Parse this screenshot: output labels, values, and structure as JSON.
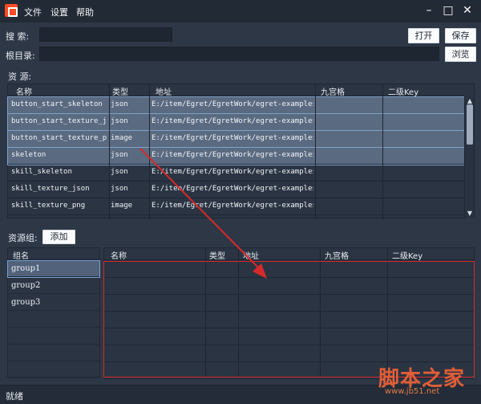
{
  "titlebar": {
    "menus": [
      "文件",
      "设置",
      "帮助"
    ],
    "window_controls": [
      "close-icon",
      "maximize-icon",
      "minimize-icon"
    ]
  },
  "search_row": {
    "label": "搜  索:",
    "value": ""
  },
  "root_row": {
    "label": "根目录:",
    "value": ""
  },
  "buttons": {
    "open": "打开",
    "save": "保存",
    "browse": "浏览",
    "add": "添加"
  },
  "resources": {
    "title": "资  源:",
    "headers": [
      "名称",
      "类型",
      "地址",
      "九宫格",
      "二级Key"
    ],
    "rows": [
      [
        "button_start_skeleton",
        "json",
        "E:/item/Egret/EgretWork/egret-examples/C",
        "",
        ""
      ],
      [
        "button_start_texture_js",
        "json",
        "E:/item/Egret/EgretWork/egret-examples/C",
        "",
        ""
      ],
      [
        "button_start_texture_pn",
        "image",
        "E:/item/Egret/EgretWork/egret-examples/C",
        "",
        ""
      ],
      [
        "skeleton",
        "json",
        "E:/item/Egret/EgretWork/egret-examples/C",
        "",
        ""
      ],
      [
        "skill_skeleton",
        "json",
        "E:/item/Egret/EgretWork/egret-examples/C",
        "",
        ""
      ],
      [
        "skill_texture_json",
        "json",
        "E:/item/Egret/EgretWork/egret-examples/C",
        "",
        ""
      ],
      [
        "skill_texture_png",
        "image",
        "E:/item/Egret/EgretWork/egret-examples/C",
        "",
        ""
      ]
    ],
    "selected_rows": [
      0,
      1,
      2,
      3
    ]
  },
  "groups": {
    "title": "资源组:",
    "list_header": "组名",
    "items": [
      "group1",
      "group2",
      "group3"
    ],
    "selected": 0
  },
  "group_resources": {
    "headers": [
      "名称",
      "类型",
      "地址",
      "九宫格",
      "二级Key"
    ]
  },
  "status": {
    "text": "就绪"
  },
  "watermark": {
    "main": "脚本之家",
    "sub": "www.jb51.net"
  },
  "colors": {
    "highlight": "#d62a2a",
    "selection": "#5a6a80",
    "logo": "#ff4a24"
  }
}
